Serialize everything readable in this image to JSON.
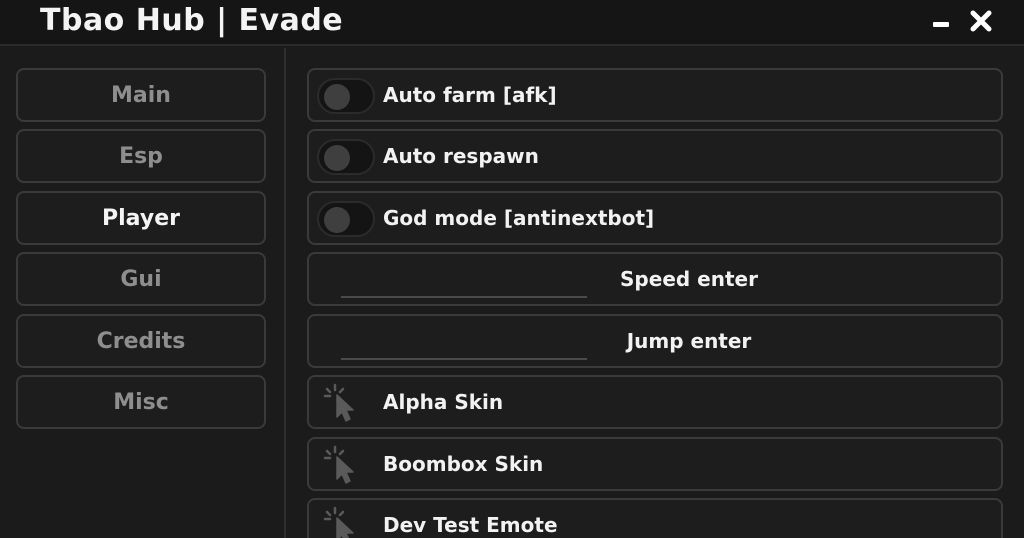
{
  "window": {
    "title": "Tbao Hub | Evade",
    "minimize_icon": "minus-icon",
    "close_icon": "close-icon"
  },
  "sidebar": {
    "tabs": [
      {
        "label": "Main",
        "active": false
      },
      {
        "label": "Esp",
        "active": false
      },
      {
        "label": "Player",
        "active": true
      },
      {
        "label": "Gui",
        "active": false
      },
      {
        "label": "Credits",
        "active": false
      },
      {
        "label": "Misc",
        "active": false
      }
    ]
  },
  "player": {
    "toggles": [
      {
        "label": "Auto farm [afk]",
        "on": false
      },
      {
        "label": "Auto respawn",
        "on": false
      },
      {
        "label": "God mode [antinextbot]",
        "on": false
      }
    ],
    "inputs": [
      {
        "label": "Speed enter",
        "value": ""
      },
      {
        "label": "Jump enter",
        "value": ""
      }
    ],
    "buttons": [
      {
        "label": "Alpha Skin",
        "icon": "cursor-click-icon"
      },
      {
        "label": "Boombox Skin",
        "icon": "cursor-click-icon"
      },
      {
        "label": "Dev Test Emote",
        "icon": "cursor-click-icon"
      }
    ]
  },
  "colors": {
    "background": "#1b1b1b",
    "titlebar": "#151515",
    "border": "#3a3a3a",
    "text_active": "#f4f4f4",
    "text_inactive": "#8e8e8e"
  }
}
